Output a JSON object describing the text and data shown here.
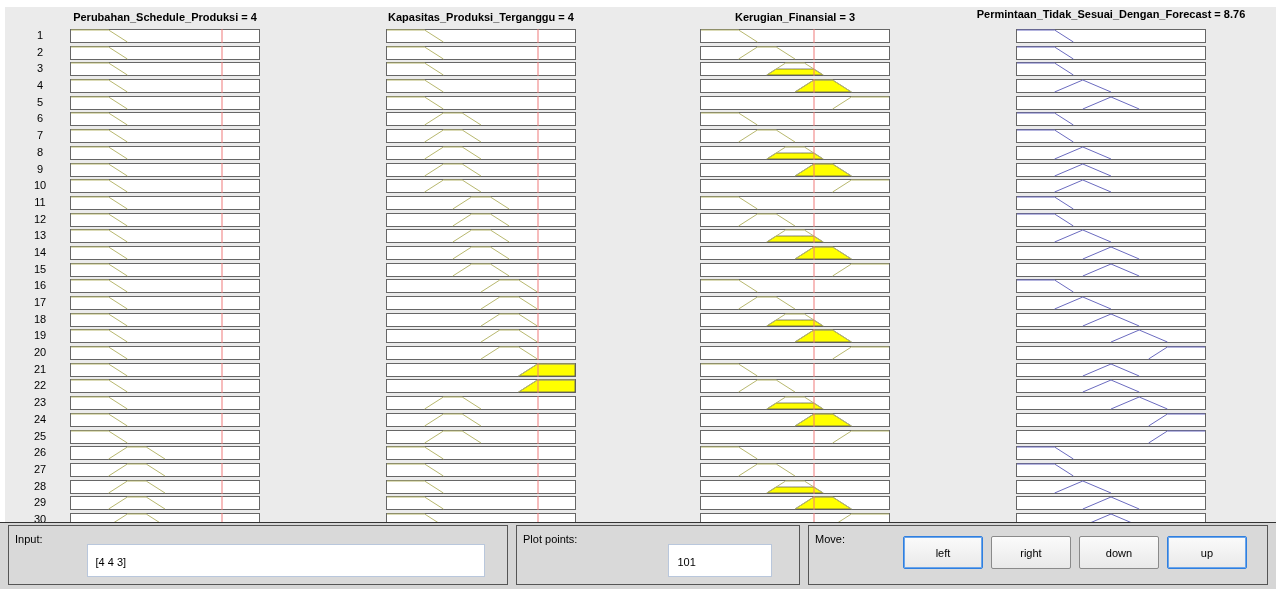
{
  "columns": [
    {
      "title": "Perubahan_Schedule_Produksi = 4",
      "kind": "input",
      "level": 0.8
    },
    {
      "title": "Kapasitas_Produksi_Terganggu = 4",
      "kind": "input",
      "level": 0.8
    },
    {
      "title": "Kerugian_Finansial = 3",
      "kind": "input",
      "level": 0.6
    },
    {
      "title": "Permintaan_Tidak_Sesuai_Dengan_Forecast = 8.76",
      "kind": "output"
    }
  ],
  "rules": [
    {
      "number": "1",
      "cells": [
        {
          "kind": "mf1"
        },
        {
          "kind": "mf1"
        },
        {
          "kind": "mf1"
        },
        {
          "kind": "mf1"
        }
      ]
    },
    {
      "number": "2",
      "cells": [
        {
          "kind": "mf1"
        },
        {
          "kind": "mf1"
        },
        {
          "kind": "mf2"
        },
        {
          "kind": "mf1"
        }
      ]
    },
    {
      "number": "3",
      "cells": [
        {
          "kind": "mf1"
        },
        {
          "kind": "mf1"
        },
        {
          "kind": "mf3"
        },
        {
          "kind": "mf1"
        }
      ]
    },
    {
      "number": "4",
      "cells": [
        {
          "kind": "mf1"
        },
        {
          "kind": "mf1"
        },
        {
          "kind": "mf4"
        },
        {
          "kind": "mf2"
        }
      ]
    },
    {
      "number": "5",
      "cells": [
        {
          "kind": "mf1"
        },
        {
          "kind": "mf1"
        },
        {
          "kind": "mf5"
        },
        {
          "kind": "mf3"
        }
      ]
    },
    {
      "number": "6",
      "cells": [
        {
          "kind": "mf1"
        },
        {
          "kind": "mf2"
        },
        {
          "kind": "mf1"
        },
        {
          "kind": "mf1"
        }
      ]
    },
    {
      "number": "7",
      "cells": [
        {
          "kind": "mf1"
        },
        {
          "kind": "mf2"
        },
        {
          "kind": "mf2"
        },
        {
          "kind": "mf1"
        }
      ]
    },
    {
      "number": "8",
      "cells": [
        {
          "kind": "mf1"
        },
        {
          "kind": "mf2"
        },
        {
          "kind": "mf3"
        },
        {
          "kind": "mf2"
        }
      ]
    },
    {
      "number": "9",
      "cells": [
        {
          "kind": "mf1"
        },
        {
          "kind": "mf2"
        },
        {
          "kind": "mf4"
        },
        {
          "kind": "mf2"
        }
      ]
    },
    {
      "number": "10",
      "cells": [
        {
          "kind": "mf1"
        },
        {
          "kind": "mf2"
        },
        {
          "kind": "mf5"
        },
        {
          "kind": "mf2"
        }
      ]
    },
    {
      "number": "11",
      "cells": [
        {
          "kind": "mf1"
        },
        {
          "kind": "mf3"
        },
        {
          "kind": "mf1"
        },
        {
          "kind": "mf1"
        }
      ]
    },
    {
      "number": "12",
      "cells": [
        {
          "kind": "mf1"
        },
        {
          "kind": "mf3"
        },
        {
          "kind": "mf2"
        },
        {
          "kind": "mf1"
        }
      ]
    },
    {
      "number": "13",
      "cells": [
        {
          "kind": "mf1"
        },
        {
          "kind": "mf3"
        },
        {
          "kind": "mf3"
        },
        {
          "kind": "mf2"
        }
      ]
    },
    {
      "number": "14",
      "cells": [
        {
          "kind": "mf1"
        },
        {
          "kind": "mf3"
        },
        {
          "kind": "mf4"
        },
        {
          "kind": "mf3"
        }
      ]
    },
    {
      "number": "15",
      "cells": [
        {
          "kind": "mf1"
        },
        {
          "kind": "mf3"
        },
        {
          "kind": "mf5"
        },
        {
          "kind": "mf3"
        }
      ]
    },
    {
      "number": "16",
      "cells": [
        {
          "kind": "mf1"
        },
        {
          "kind": "mf4"
        },
        {
          "kind": "mf1"
        },
        {
          "kind": "mf1"
        }
      ]
    },
    {
      "number": "17",
      "cells": [
        {
          "kind": "mf1"
        },
        {
          "kind": "mf4"
        },
        {
          "kind": "mf2"
        },
        {
          "kind": "mf2"
        }
      ]
    },
    {
      "number": "18",
      "cells": [
        {
          "kind": "mf1"
        },
        {
          "kind": "mf4"
        },
        {
          "kind": "mf3"
        },
        {
          "kind": "mf3"
        }
      ]
    },
    {
      "number": "19",
      "cells": [
        {
          "kind": "mf1"
        },
        {
          "kind": "mf4"
        },
        {
          "kind": "mf4"
        },
        {
          "kind": "mf4"
        }
      ]
    },
    {
      "number": "20",
      "cells": [
        {
          "kind": "mf1"
        },
        {
          "kind": "mf4"
        },
        {
          "kind": "mf5"
        },
        {
          "kind": "mf5"
        }
      ]
    },
    {
      "number": "21",
      "cells": [
        {
          "kind": "mf1"
        },
        {
          "kind": "mf5"
        },
        {
          "kind": "mf1"
        },
        {
          "kind": "mf3"
        }
      ]
    },
    {
      "number": "22",
      "cells": [
        {
          "kind": "mf1"
        },
        {
          "kind": "mf5"
        },
        {
          "kind": "mf2"
        },
        {
          "kind": "mf3"
        }
      ]
    },
    {
      "number": "23",
      "cells": [
        {
          "kind": "mf1"
        },
        {
          "kind": "mf2"
        },
        {
          "kind": "mf3"
        },
        {
          "kind": "mf4"
        }
      ]
    },
    {
      "number": "24",
      "cells": [
        {
          "kind": "mf1"
        },
        {
          "kind": "mf2"
        },
        {
          "kind": "mf4"
        },
        {
          "kind": "mf5"
        }
      ]
    },
    {
      "number": "25",
      "cells": [
        {
          "kind": "mf1"
        },
        {
          "kind": "mf2"
        },
        {
          "kind": "mf5"
        },
        {
          "kind": "mf5"
        }
      ]
    },
    {
      "number": "26",
      "cells": [
        {
          "kind": "mf2"
        },
        {
          "kind": "mf1"
        },
        {
          "kind": "mf1"
        },
        {
          "kind": "mf1"
        }
      ]
    },
    {
      "number": "27",
      "cells": [
        {
          "kind": "mf2"
        },
        {
          "kind": "mf1"
        },
        {
          "kind": "mf2"
        },
        {
          "kind": "mf1"
        }
      ]
    },
    {
      "number": "28",
      "cells": [
        {
          "kind": "mf2"
        },
        {
          "kind": "mf1"
        },
        {
          "kind": "mf3"
        },
        {
          "kind": "mf2"
        }
      ]
    },
    {
      "number": "29",
      "cells": [
        {
          "kind": "mf2"
        },
        {
          "kind": "mf1"
        },
        {
          "kind": "mf4"
        },
        {
          "kind": "mf3"
        }
      ]
    },
    {
      "number": "30",
      "cells": [
        {
          "kind": "mf2"
        },
        {
          "kind": "mf1"
        },
        {
          "kind": "mf5"
        },
        {
          "kind": "mf3"
        }
      ]
    }
  ],
  "input": {
    "label": "Input:",
    "value": "[4 4 3]"
  },
  "plot_points": {
    "label": "Plot points:",
    "value": "101"
  },
  "move": {
    "label": "Move:",
    "buttons": [
      {
        "label": "left",
        "highlighted": true
      },
      {
        "label": "right",
        "highlighted": false
      },
      {
        "label": "down",
        "highlighted": false
      },
      {
        "label": "up",
        "highlighted": true
      }
    ]
  }
}
